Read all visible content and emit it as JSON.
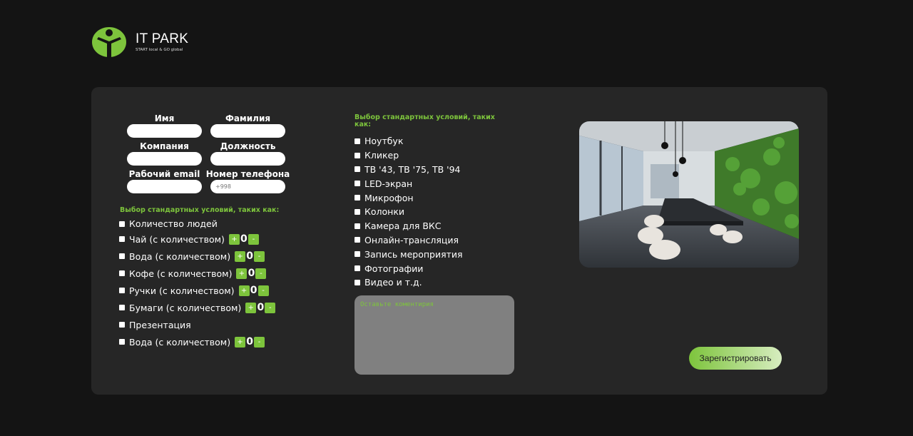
{
  "brand": {
    "title": "IT PARK",
    "subtitle": "START local & GO global",
    "accent": "#7dc43c"
  },
  "form": {
    "fields": [
      {
        "label": "Имя",
        "value": "",
        "placeholder": ""
      },
      {
        "label": "Фамилия",
        "value": "",
        "placeholder": ""
      },
      {
        "label": "Компания",
        "value": "",
        "placeholder": ""
      },
      {
        "label": "Должность",
        "value": "",
        "placeholder": ""
      },
      {
        "label": "Рабочий email",
        "value": "",
        "placeholder": ""
      },
      {
        "label": "Номер телефона",
        "value": "",
        "placeholder": "+998"
      }
    ]
  },
  "left_section": {
    "title": "Выбор стандартных условий, таких как:",
    "items": [
      {
        "label": "Количество людей",
        "stepper": false
      },
      {
        "label": "Чай (с количеством)",
        "stepper": true,
        "count": "0",
        "plus": "+",
        "minus": "-"
      },
      {
        "label": "Вода (с количеством)",
        "stepper": true,
        "count": "0",
        "plus": "+",
        "minus": "-"
      },
      {
        "label": "Кофе (с количеством)",
        "stepper": true,
        "count": "0",
        "plus": "+",
        "minus": "-"
      },
      {
        "label": "Ручки (с количеством)",
        "stepper": true,
        "count": "0",
        "plus": "+",
        "minus": "-"
      },
      {
        "label": "Бумаги (с количеством)",
        "stepper": true,
        "count": "0",
        "plus": "+",
        "minus": "-"
      },
      {
        "label": "Презентация",
        "stepper": false
      },
      {
        "label": "Вода (с количеством)",
        "stepper": true,
        "count": "0",
        "plus": "+",
        "minus": "-"
      }
    ]
  },
  "right_section": {
    "title": "Выбор стандартных условий, таких как:",
    "items": [
      "Ноутбук",
      "Кликер",
      "ТВ '43, ТВ '75, ТВ '94",
      "LED-экран",
      "Микрофон",
      "Колонки",
      "Камера для ВКС",
      "Онлайн-трансляция",
      "Запись мероприятия",
      "Фотографии",
      "Видео и т.д."
    ]
  },
  "comment": {
    "placeholder": "Оставьте коментирия",
    "value": ""
  },
  "submit": {
    "label": "Зарегистрировать"
  },
  "image": {
    "subject": "conference-room-photo"
  }
}
